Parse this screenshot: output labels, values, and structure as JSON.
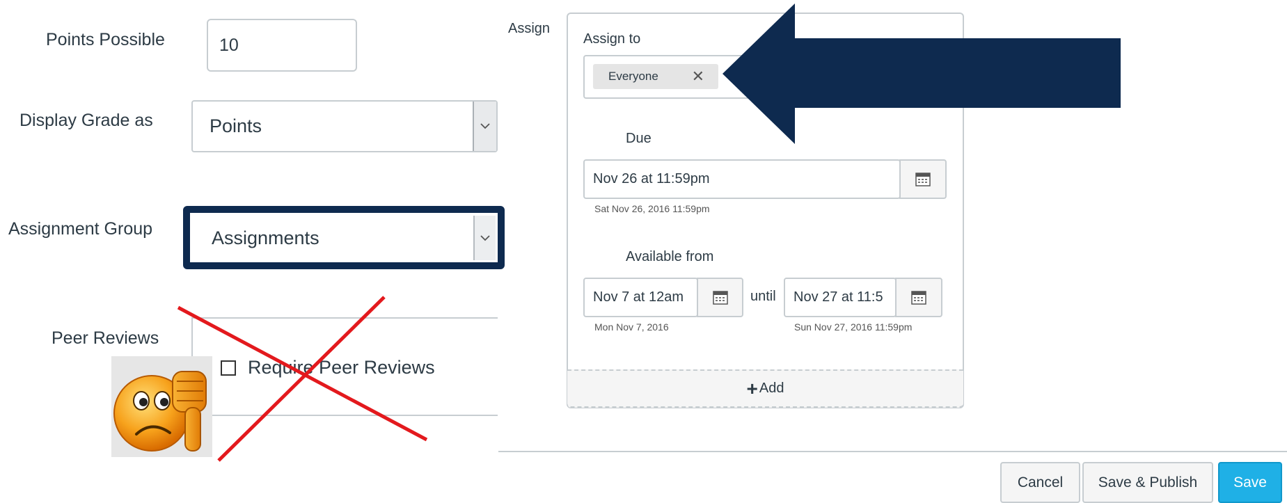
{
  "form": {
    "points_possible_label": "Points Possible",
    "points_possible_value": "10",
    "display_grade_label": "Display Grade as",
    "display_grade_value": "Points",
    "assignment_group_label": "Assignment Group",
    "assignment_group_value": "Assignments",
    "peer_reviews_label": "Peer Reviews",
    "require_peer_reviews_label": "Require Peer Reviews"
  },
  "assign": {
    "section_label": "Assign",
    "assign_to_label": "Assign to",
    "token_label": "Everyone",
    "due_label": "Due",
    "due_value": "Nov 26 at 11:59pm",
    "due_hint": "Sat Nov 26, 2016 11:59pm",
    "available_from_label": "Available from",
    "available_from_value": "Nov 7 at 12am",
    "available_from_hint": "Mon Nov 7, 2016",
    "until_label": "until",
    "until_value": "Nov 27 at 11:5",
    "until_hint": "Sun Nov 27, 2016 11:59pm",
    "add_label": "Add"
  },
  "footer": {
    "cancel_label": "Cancel",
    "save_publish_label": "Save & Publish",
    "save_label": "Save"
  },
  "colors": {
    "highlight_navy": "#0e2a4f",
    "cross_red": "#e3191d",
    "save_blue": "#1fb0e6"
  },
  "annotations": {
    "arrow_icon": "left-arrow-icon",
    "emoji_icon": "thumbs-down-sad-emoji-icon",
    "cross_icon": "red-x-cross-icon"
  }
}
